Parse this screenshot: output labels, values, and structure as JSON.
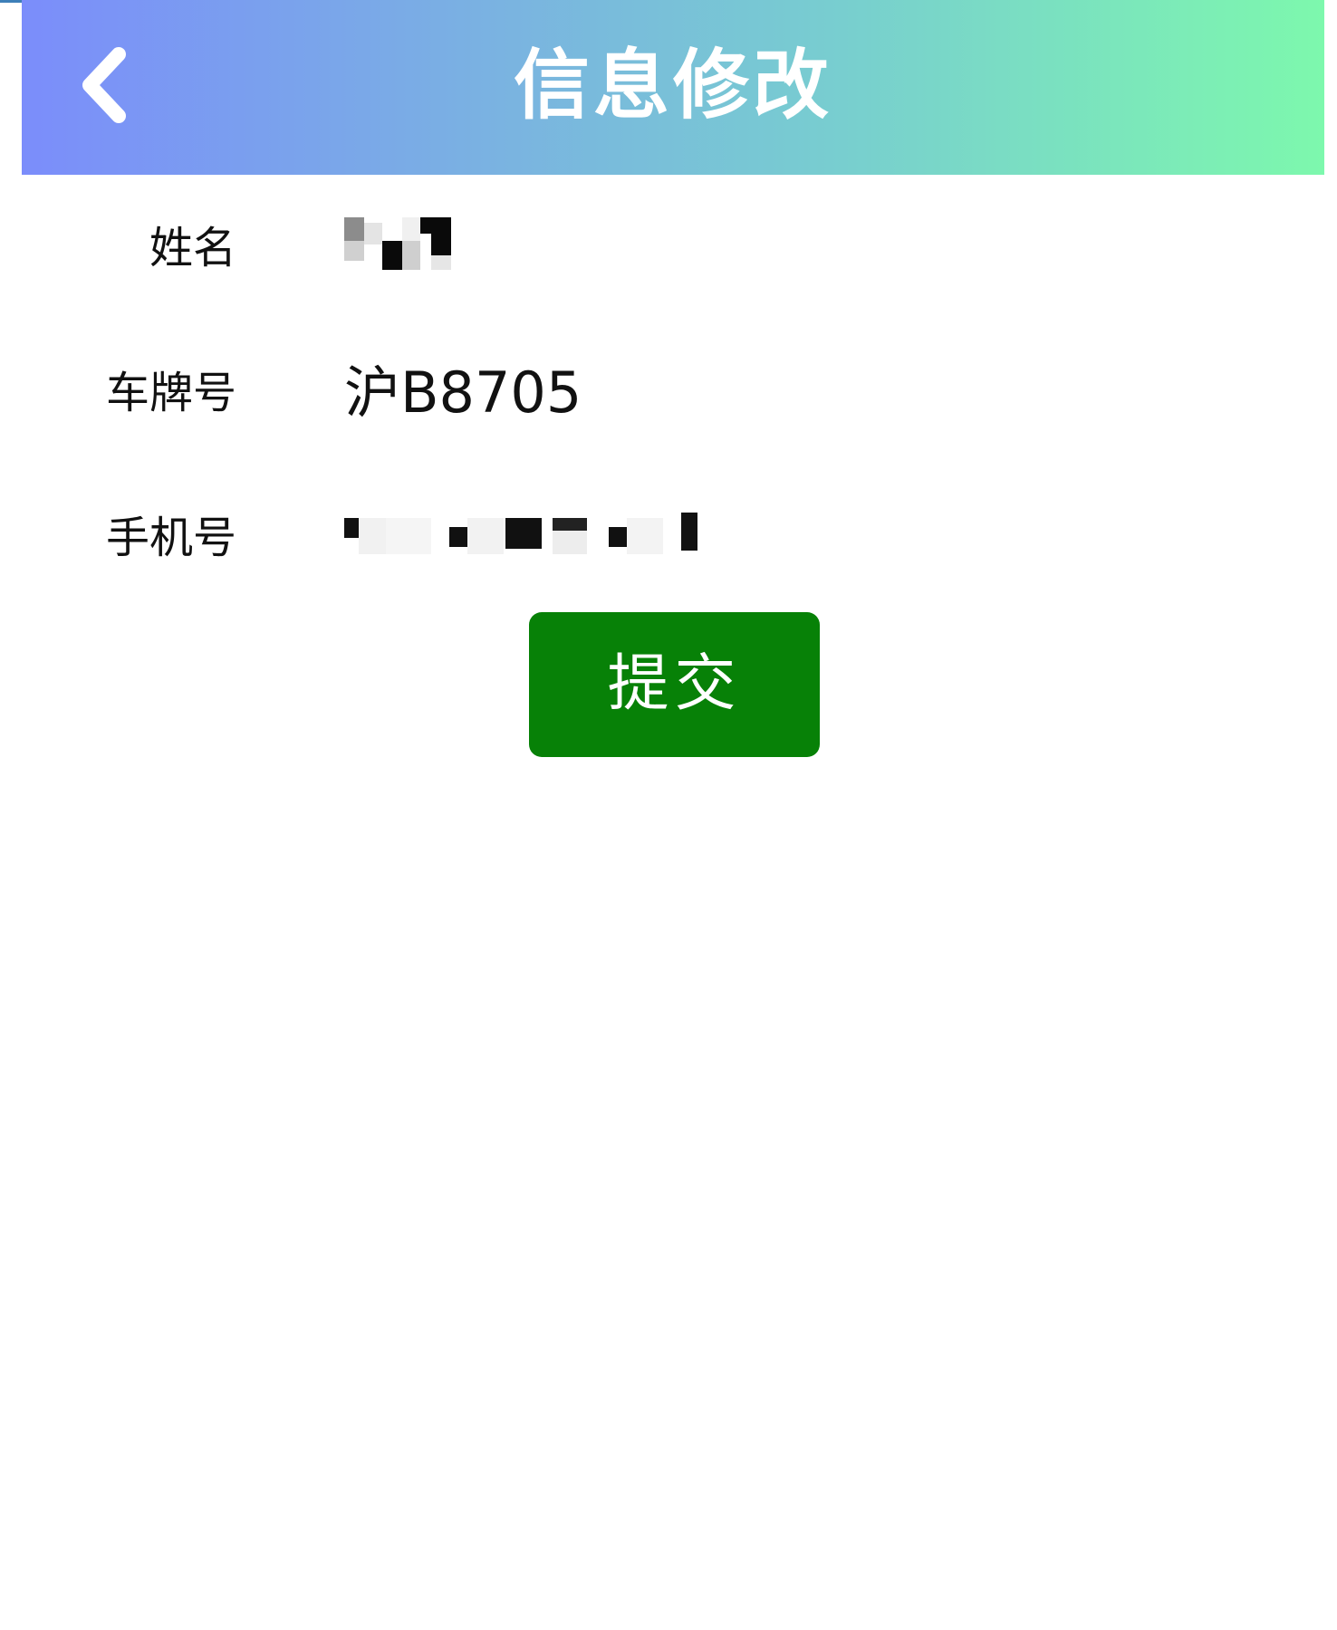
{
  "header": {
    "title": "信息修改",
    "back_icon": "chevron-left-icon"
  },
  "form": {
    "name_label": "姓名",
    "plate_label": "车牌号",
    "plate_value": "沪B8705",
    "phone_label": "手机号"
  },
  "submit": {
    "label": "提交"
  },
  "colors": {
    "header_gradient_start": "#7b8dfb",
    "header_gradient_end": "#7df8ad",
    "submit_bg": "#078107"
  }
}
